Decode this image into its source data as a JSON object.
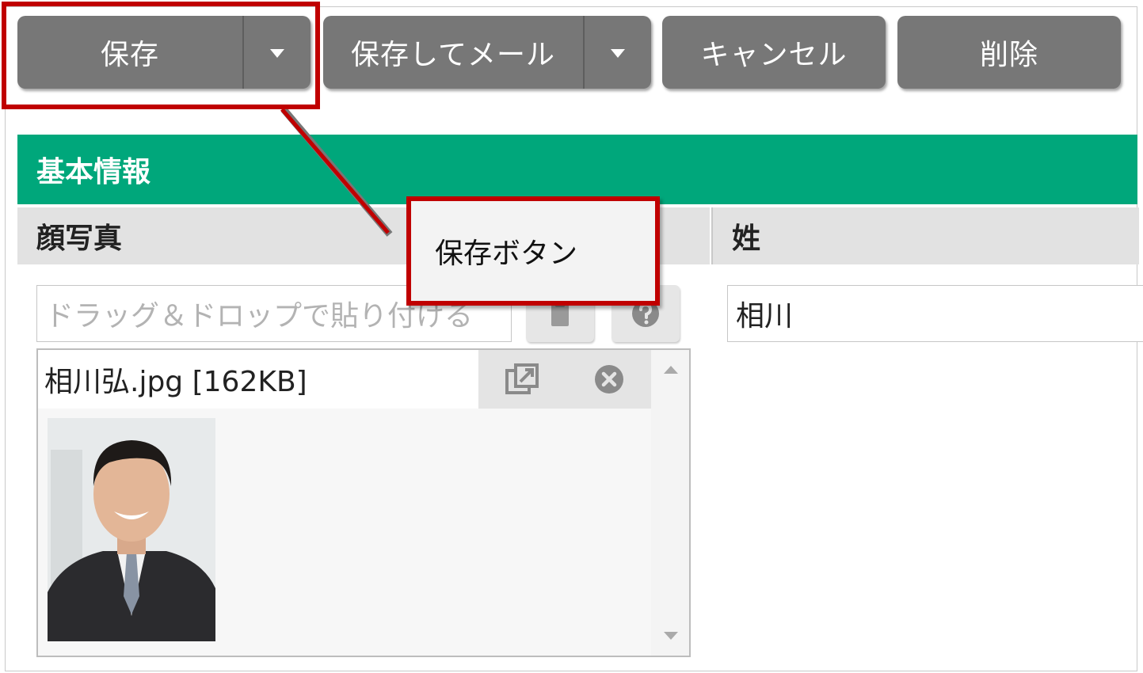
{
  "toolbar": {
    "save_label": "保存",
    "save_mail_label": "保存してメール",
    "cancel_label": "キャンセル",
    "delete_label": "削除"
  },
  "section": {
    "title": "基本情報"
  },
  "columns": {
    "photo": "顔写真",
    "surname": "姓"
  },
  "photo_field": {
    "drop_placeholder": "ドラッグ＆ドロップで貼り付ける",
    "file_name": "相川弘.jpg [162KB]"
  },
  "surname_field": {
    "value": "相川"
  },
  "callout": {
    "text": "保存ボタン"
  },
  "colors": {
    "header_green": "#00a77b",
    "button_gray": "#777777",
    "highlight_red": "#c00000"
  },
  "icons": [
    "chevron-down-icon",
    "paste-icon",
    "help-icon",
    "open-external-icon",
    "remove-circle-icon",
    "scroll-up-icon",
    "scroll-down-icon"
  ]
}
